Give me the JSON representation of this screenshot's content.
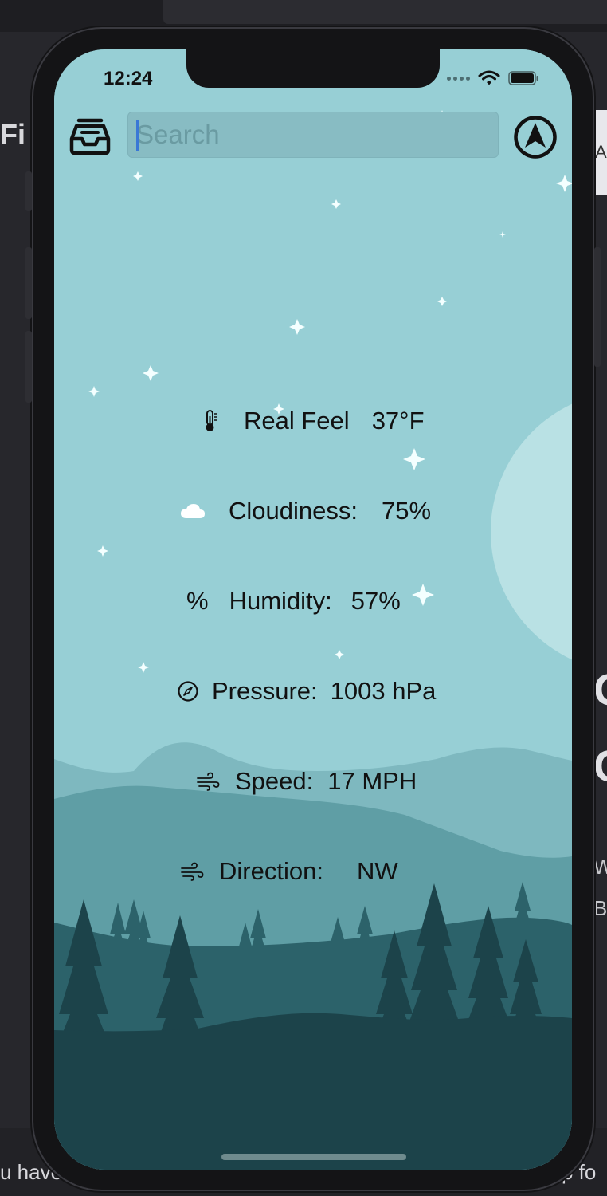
{
  "background": {
    "left_text": "Fi",
    "right_card_text": "A",
    "right_big_1": "G",
    "right_big_2": "C",
    "right_small_1": "W",
    "right_small_2": "B",
    "bottom_left": "u have",
    "bottom_right": "p fo"
  },
  "status_bar": {
    "time": "12:24"
  },
  "search": {
    "placeholder": "Search",
    "value": ""
  },
  "icons": {
    "inbox": "inbox-icon",
    "navigation": "location-arrow-icon",
    "thermometer": "thermometer-icon",
    "cloud": "cloud-icon",
    "compass": "compass-icon",
    "wind": "wind-icon"
  },
  "weather": {
    "real_feel": {
      "label": "Real Feel",
      "value": "37°F"
    },
    "cloudiness": {
      "label": "Cloudiness:",
      "value": "75%"
    },
    "humidity": {
      "symbol": "%",
      "label": "Humidity:",
      "value": "57%"
    },
    "pressure": {
      "label": "Pressure:",
      "value": "1003 hPa"
    },
    "speed": {
      "label": "Speed:",
      "value": "17 MPH"
    },
    "direction": {
      "label": "Direction:",
      "value": "NW"
    }
  },
  "colors": {
    "sky": "#97cfd5",
    "moon": "#b9e1e4",
    "hill_far": "#7eb8bf",
    "hill_mid": "#5f9ea5",
    "forest": "#2c626a",
    "ground": "#1c434a",
    "text": "#111111"
  }
}
